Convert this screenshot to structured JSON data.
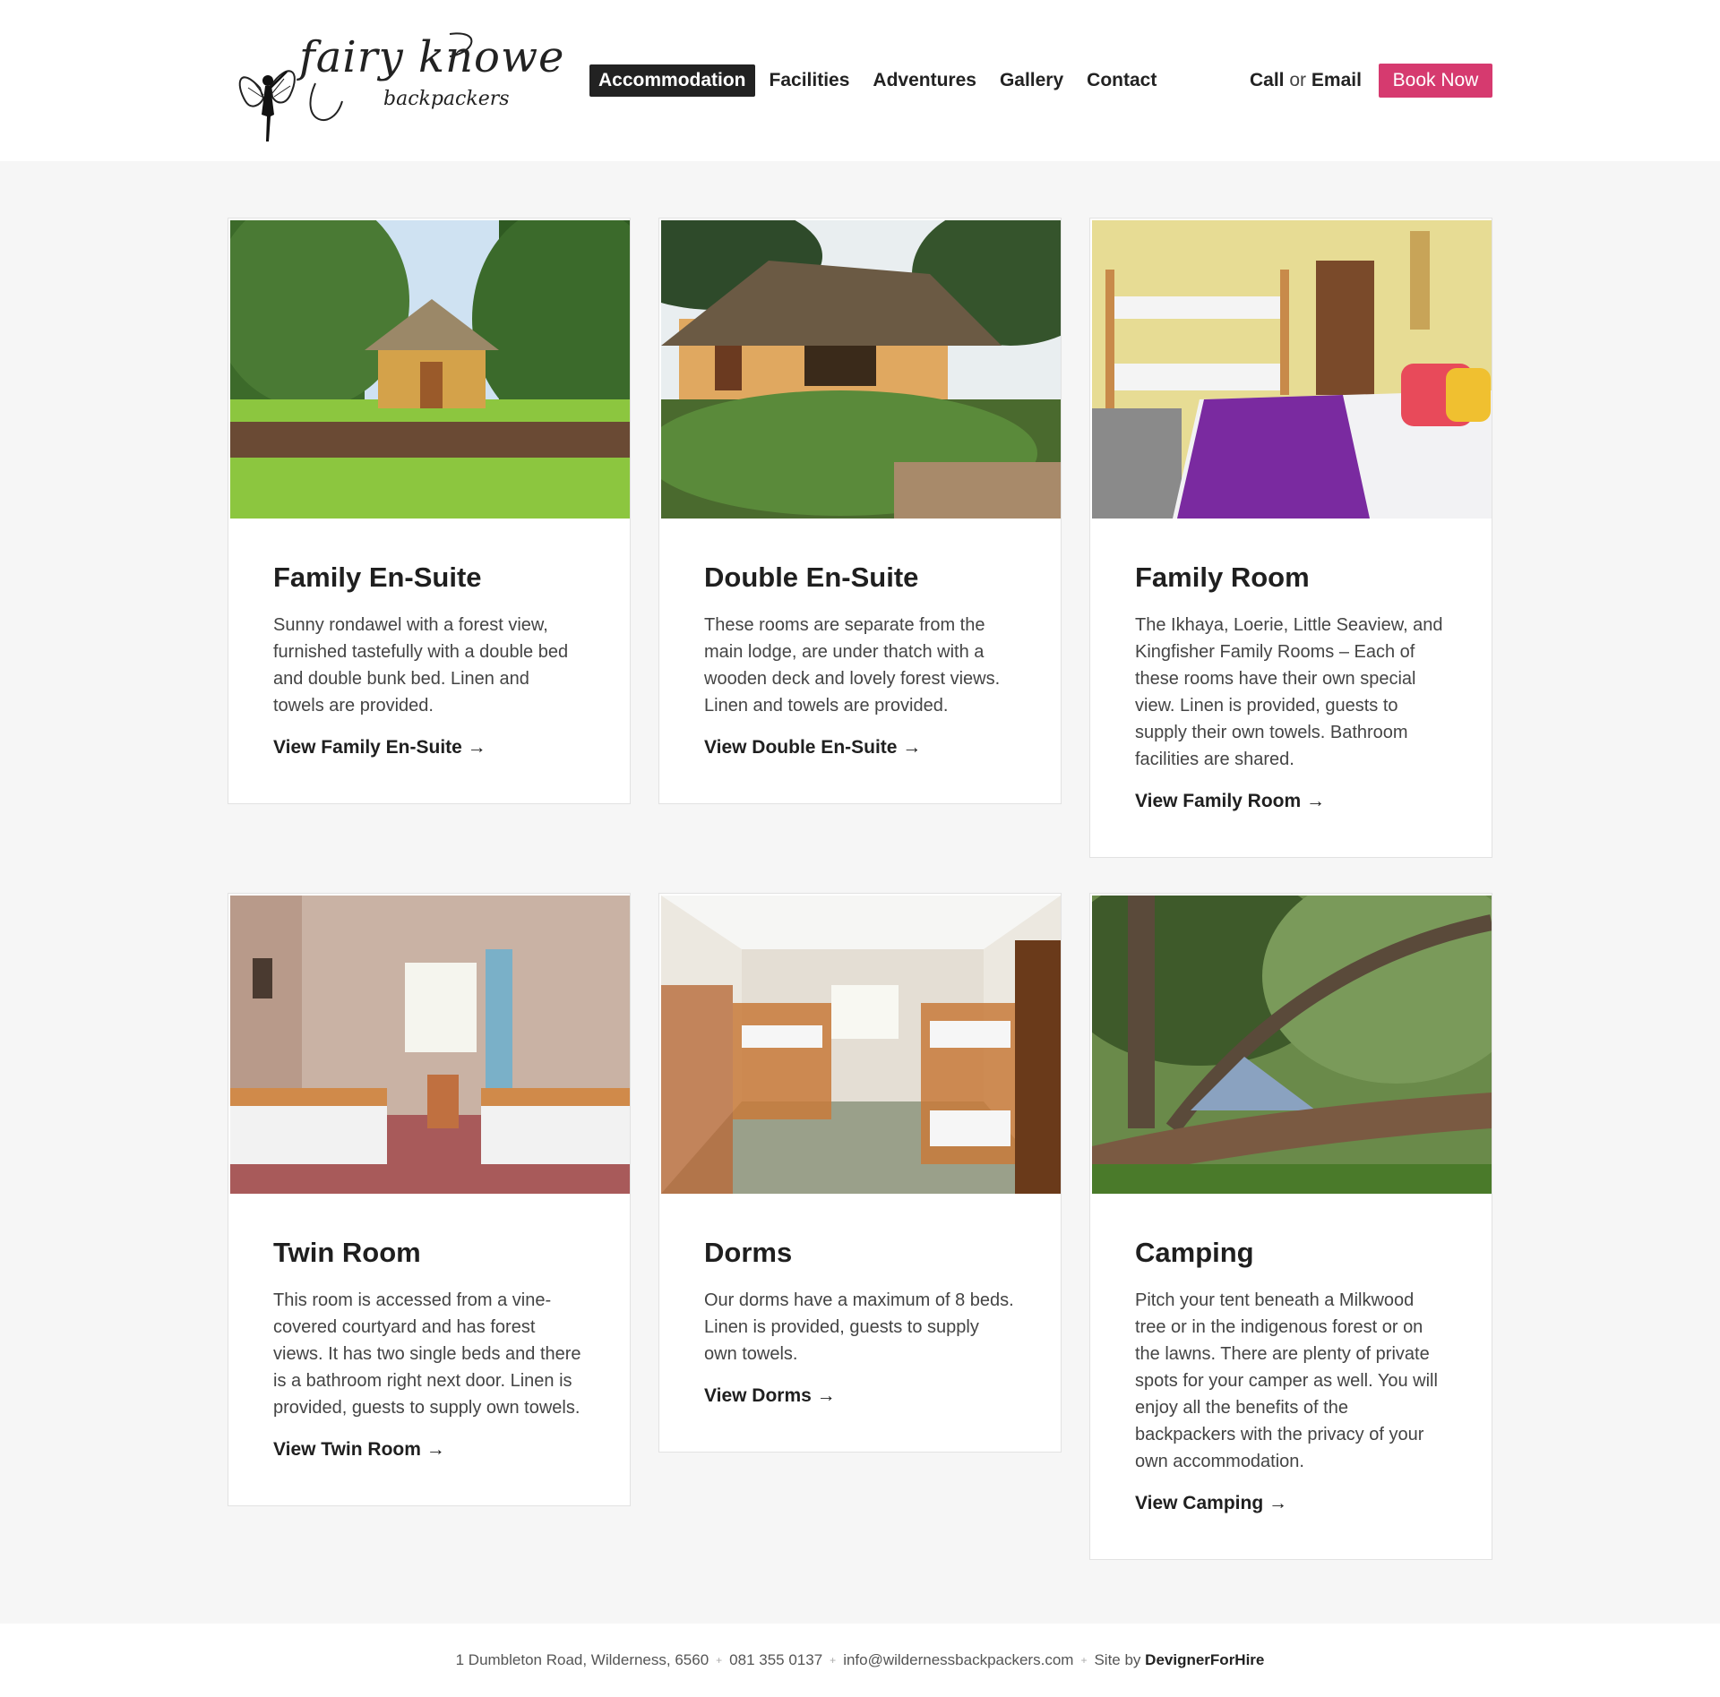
{
  "brand": {
    "name": "fairy knowe",
    "sub": "backpackers"
  },
  "nav": {
    "items": [
      {
        "label": "Accommodation",
        "active": true
      },
      {
        "label": "Facilities"
      },
      {
        "label": "Adventures"
      },
      {
        "label": "Gallery"
      },
      {
        "label": "Contact"
      }
    ],
    "call": "Call",
    "or": "or",
    "email": "Email",
    "book_label": "Book Now"
  },
  "colors": {
    "accent": "#d63a6f",
    "background": "#f6f6f6"
  },
  "cards": [
    {
      "title": "Family En-Suite",
      "text": "Sunny rondawel with a forest view, furnished tastefully with a double bed and double bunk bed. Linen and towels are provided.",
      "link": "View Family En-Suite →",
      "image": "thatched-rondawel-photo"
    },
    {
      "title": "Double En-Suite",
      "text": "These rooms are separate from the main lodge, are under thatch with a wooden deck and lovely forest views. Linen and towels are provided.",
      "link": "View Double En-Suite →",
      "image": "thatched-cottage-photo"
    },
    {
      "title": "Family Room",
      "text": "The Ikhaya, Loerie, Little Seaview, and Kingfisher Family Rooms – Each of these rooms have their own special view. Linen is provided, guests to supply their own towels. Bathroom facilities are shared.",
      "link": "View Family Room →",
      "image": "bunk-and-double-bed-photo"
    },
    {
      "title": "Twin Room",
      "text": "This room is accessed from a vine-covered courtyard and has forest views. It has two single beds and there is a bathroom right next door. Linen is provided, guests to supply own towels.",
      "link": "View Twin Room →",
      "image": "twin-beds-photo"
    },
    {
      "title": "Dorms",
      "text": "Our dorms have a maximum of 8 beds. Linen is provided, guests to supply own towels.",
      "link": "View Dorms →",
      "image": "dorm-bunks-photo"
    },
    {
      "title": "Camping",
      "text": "Pitch your tent beneath a Milkwood tree or in the indigenous forest or on the lawns. There are plenty of private spots for your camper as well. You will enjoy all the benefits of the backpackers with the privacy of your own accommodation.",
      "link": "View Camping →",
      "image": "tent-under-trees-photo"
    }
  ],
  "footer": {
    "address": "1 Dumbleton Road, Wilderness, 6560",
    "phone": "081 355 0137",
    "email": "info@wildernessbackpackers.com",
    "site_by": "Site by",
    "designer": "DevignerForHire",
    "separator": "+"
  }
}
